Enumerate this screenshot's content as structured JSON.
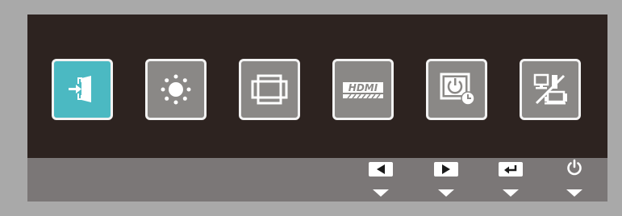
{
  "colors": {
    "bezel": "#a9a9a9",
    "panel": "#2d2320",
    "bottom_bar": "#7b7777",
    "tile": "#8a8886",
    "tile_active": "#4bb9c2",
    "tile_border": "#f2f2f2",
    "button_face": "#ffffff"
  },
  "menu": {
    "selected_index": 0,
    "items": [
      {
        "icon": "input-source-icon",
        "active": true
      },
      {
        "icon": "brightness-icon",
        "active": false
      },
      {
        "icon": "picture-size-icon",
        "active": false
      },
      {
        "icon": "hdmi-icon",
        "active": false,
        "icon_text": "HDMI"
      },
      {
        "icon": "power-timer-icon",
        "active": false
      },
      {
        "icon": "pc-av-mode-icon",
        "active": false
      }
    ]
  },
  "buttons": [
    {
      "icon": "left-arrow-icon"
    },
    {
      "icon": "right-arrow-icon"
    },
    {
      "icon": "enter-return-icon"
    },
    {
      "icon": "power-icon"
    }
  ]
}
